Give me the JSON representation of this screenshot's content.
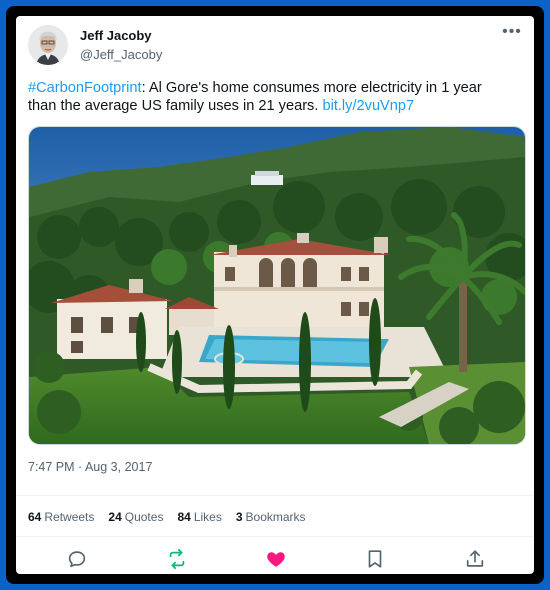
{
  "user": {
    "name": "Jeff Jacoby",
    "handle": "@Jeff_Jacoby"
  },
  "menu": {
    "more_label": "•••"
  },
  "tweet": {
    "hashtag": "#CarbonFootprint",
    "text": ": Al Gore's home consumes more electricity in 1 year than the average US family uses in 21 years. ",
    "link": "bit.ly/2vuVnp7"
  },
  "timestamp": "7:47 PM · Aug 3, 2017",
  "stats": {
    "retweets": {
      "count": "64",
      "label": "Retweets"
    },
    "quotes": {
      "count": "24",
      "label": "Quotes"
    },
    "likes": {
      "count": "84",
      "label": "Likes"
    },
    "bookmarks": {
      "count": "3",
      "label": "Bookmarks"
    }
  },
  "colors": {
    "link": "#1d9bf0",
    "retweet": "#00ba7c",
    "like": "#f91880",
    "border": "#0b62c9"
  },
  "icons": {
    "reply": "reply-icon",
    "retweet": "retweet-icon",
    "like": "heart-icon",
    "bookmark": "bookmark-icon",
    "share": "share-icon"
  }
}
